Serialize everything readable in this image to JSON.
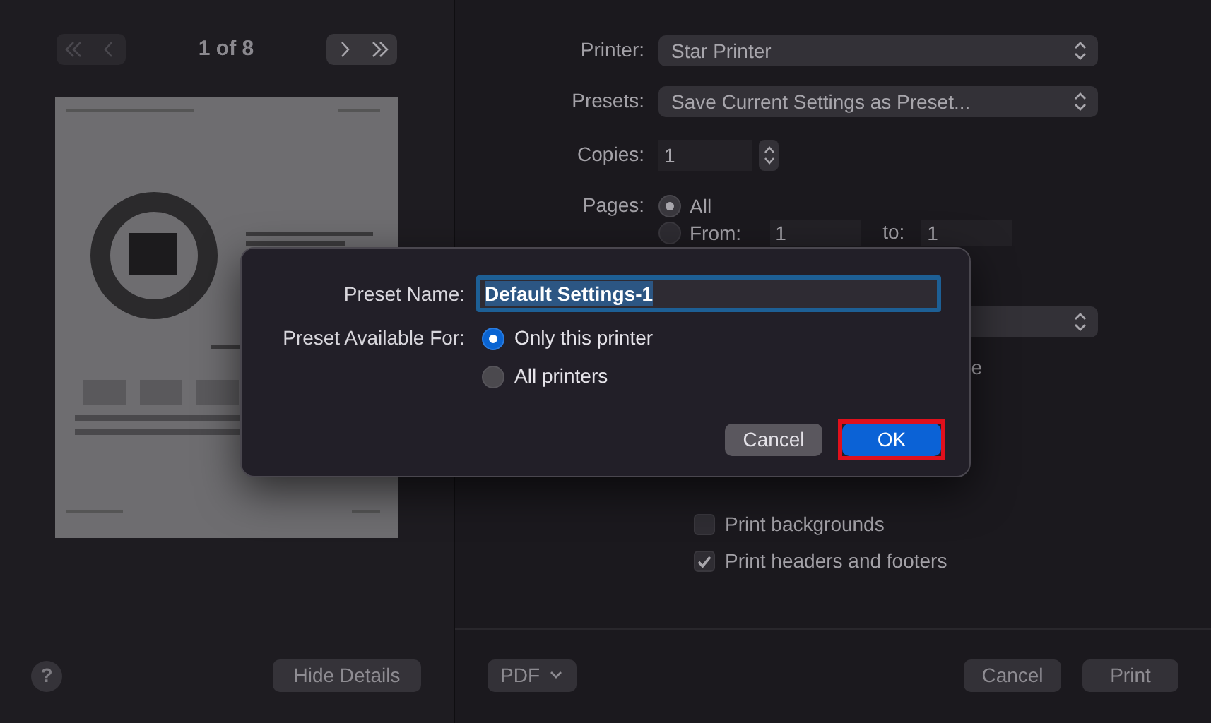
{
  "preview": {
    "page_counter": "1 of 8",
    "first_disabled": true,
    "last_disabled": false,
    "help": "?",
    "hide_details": "Hide Details"
  },
  "settings": {
    "printer": {
      "label": "Printer:",
      "value": "Star Printer"
    },
    "presets": {
      "label": "Presets:",
      "value": "Save Current Settings as Preset..."
    },
    "copies": {
      "label": "Copies:",
      "value": "1"
    },
    "pages": {
      "label": "Pages:",
      "options": [
        {
          "label": "All",
          "selected": true
        },
        {
          "label": "From:",
          "selected": false
        }
      ],
      "from": "1",
      "to_label": "to:",
      "to": "1"
    },
    "hidden_text_tail": "e",
    "checkboxes": [
      {
        "label": "Print backgrounds",
        "checked": false
      },
      {
        "label": "Print headers and footers",
        "checked": true
      }
    ]
  },
  "footer": {
    "pdf": "PDF",
    "cancel": "Cancel",
    "print": "Print"
  },
  "dialog": {
    "name_label": "Preset Name:",
    "name_value": "Default Settings-1",
    "available_label": "Preset Available For:",
    "options": [
      {
        "label": "Only this printer",
        "selected": true
      },
      {
        "label": "All printers",
        "selected": false
      }
    ],
    "buttons": [
      {
        "label": "Cancel",
        "kind": "secondary",
        "highlighted": false
      },
      {
        "label": "OK",
        "kind": "primary",
        "highlighted": true
      }
    ]
  }
}
